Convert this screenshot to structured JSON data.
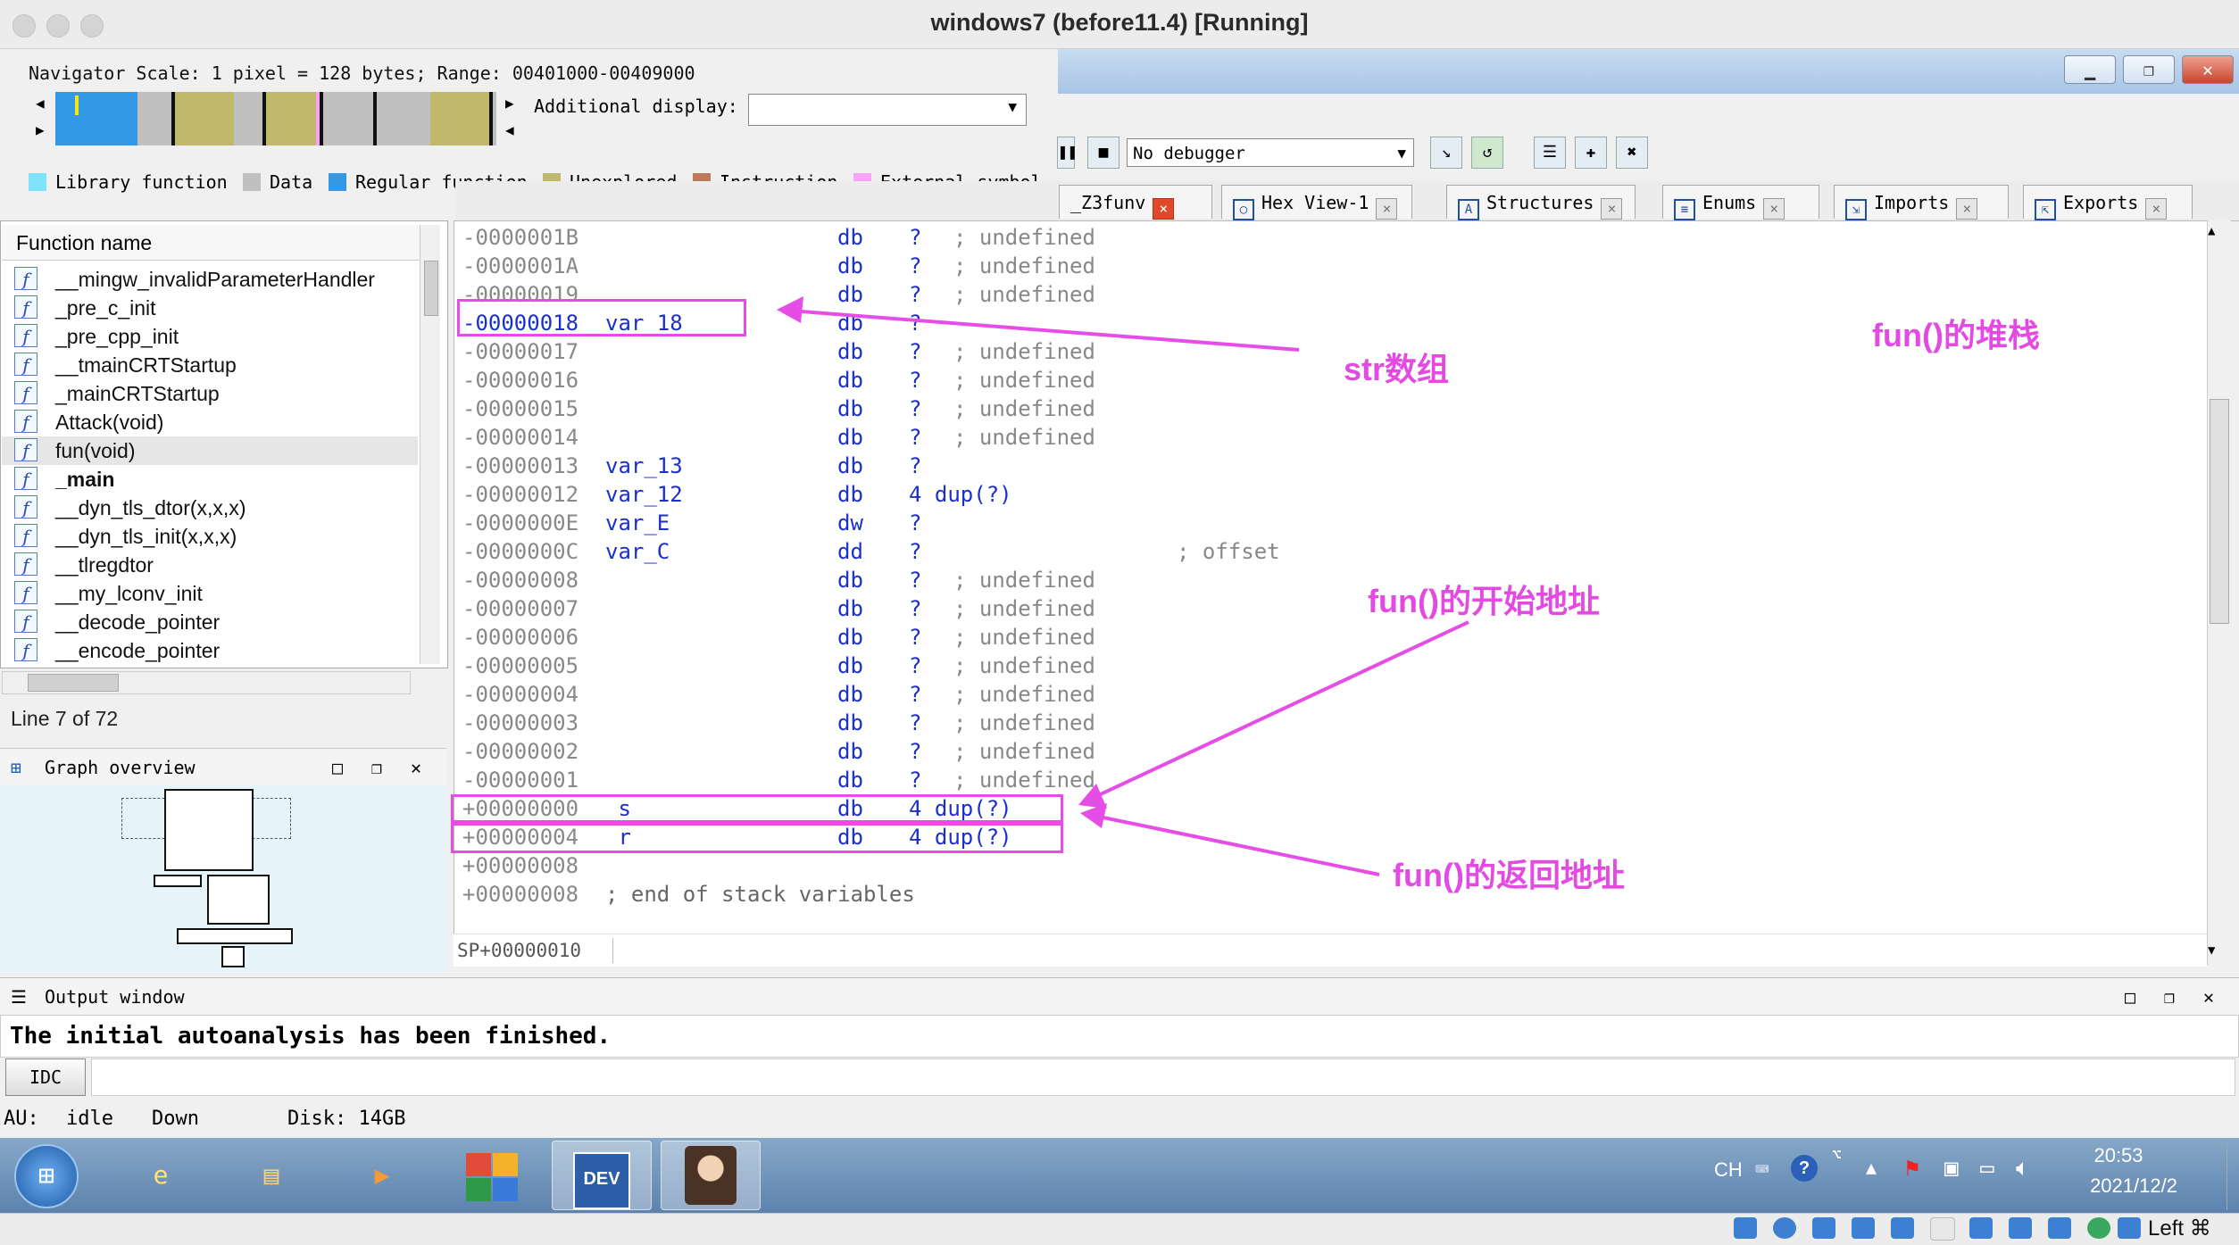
{
  "window": {
    "title": "windows7 (before11.4) [Running]"
  },
  "navigator": {
    "scale_text": "Navigator Scale: 1 pixel = 128 bytes; Range: 00401000-00409000",
    "additional_display_label": "Additional display:",
    "legend": [
      {
        "label": "Library function",
        "color": "#7fe3f9"
      },
      {
        "label": "Data",
        "color": "#c0c0c0"
      },
      {
        "label": "Regular function",
        "color": "#3399e6"
      },
      {
        "label": "Unexplored",
        "color": "#c0b86a"
      },
      {
        "label": "Instruction",
        "color": "#c0785a"
      },
      {
        "label": "External symbol",
        "color": "#f7a4f7"
      }
    ]
  },
  "toolbar": {
    "debugger_select": "No debugger"
  },
  "tabs": [
    {
      "label": "_Z3funv",
      "active": true
    },
    {
      "label": "Hex View-1"
    },
    {
      "label": "Structures"
    },
    {
      "label": "Enums"
    },
    {
      "label": "Imports"
    },
    {
      "label": "Exports"
    }
  ],
  "functions": {
    "header": "Function name",
    "items": [
      "__mingw_invalidParameterHandler",
      "_pre_c_init",
      "_pre_cpp_init",
      "__tmainCRTStartup",
      "_mainCRTStartup",
      "Attack(void)",
      "fun(void)",
      "_main",
      "__dyn_tls_dtor(x,x,x)",
      "__dyn_tls_init(x,x,x)",
      "__tlregdtor",
      "__my_lconv_init",
      "__decode_pointer",
      "__encode_pointer"
    ],
    "selected": "fun(void)",
    "line_status": "Line 7 of 72"
  },
  "graph_overview": {
    "title": "Graph overview"
  },
  "stack": {
    "lines": [
      {
        "addr": "-0000001B",
        "name": "",
        "ins": "db",
        "op": "?",
        "cmt": "; undefined"
      },
      {
        "addr": "-0000001A",
        "name": "",
        "ins": "db",
        "op": "?",
        "cmt": "; undefined"
      },
      {
        "addr": "-00000019",
        "name": "",
        "ins": "db",
        "op": "?",
        "cmt": "; undefined"
      },
      {
        "addr": "-00000018",
        "name": "var_18",
        "ins": "db",
        "op": "?",
        "cmt": ""
      },
      {
        "addr": "-00000017",
        "name": "",
        "ins": "db",
        "op": "?",
        "cmt": "; undefined"
      },
      {
        "addr": "-00000016",
        "name": "",
        "ins": "db",
        "op": "?",
        "cmt": "; undefined"
      },
      {
        "addr": "-00000015",
        "name": "",
        "ins": "db",
        "op": "?",
        "cmt": "; undefined"
      },
      {
        "addr": "-00000014",
        "name": "",
        "ins": "db",
        "op": "?",
        "cmt": "; undefined"
      },
      {
        "addr": "-00000013",
        "name": "var_13",
        "ins": "db",
        "op": "?",
        "cmt": ""
      },
      {
        "addr": "-00000012",
        "name": "var_12",
        "ins": "db",
        "op": "4 dup(?)",
        "cmt": ""
      },
      {
        "addr": "-0000000E",
        "name": "var_E",
        "ins": "dw",
        "op": "?",
        "cmt": ""
      },
      {
        "addr": "-0000000C",
        "name": "var_C",
        "ins": "dd",
        "op": "?",
        "cmt": "; offset"
      },
      {
        "addr": "-00000008",
        "name": "",
        "ins": "db",
        "op": "?",
        "cmt": "; undefined"
      },
      {
        "addr": "-00000007",
        "name": "",
        "ins": "db",
        "op": "?",
        "cmt": "; undefined"
      },
      {
        "addr": "-00000006",
        "name": "",
        "ins": "db",
        "op": "?",
        "cmt": "; undefined"
      },
      {
        "addr": "-00000005",
        "name": "",
        "ins": "db",
        "op": "?",
        "cmt": "; undefined"
      },
      {
        "addr": "-00000004",
        "name": "",
        "ins": "db",
        "op": "?",
        "cmt": "; undefined"
      },
      {
        "addr": "-00000003",
        "name": "",
        "ins": "db",
        "op": "?",
        "cmt": "; undefined"
      },
      {
        "addr": "-00000002",
        "name": "",
        "ins": "db",
        "op": "?",
        "cmt": "; undefined"
      },
      {
        "addr": "-00000001",
        "name": "",
        "ins": "db",
        "op": "?",
        "cmt": "; undefined"
      },
      {
        "addr": "+00000000",
        "name": " s",
        "ins": "db",
        "op": "4 dup(?)",
        "cmt": ""
      },
      {
        "addr": "+00000004",
        "name": " r",
        "ins": "db",
        "op": "4 dup(?)",
        "cmt": ""
      },
      {
        "addr": "+00000008",
        "name": "",
        "ins": "",
        "op": "",
        "cmt": ""
      },
      {
        "addr": "+00000008",
        "name": "; end of stack variables",
        "ins": "",
        "op": "",
        "cmt": ""
      }
    ],
    "sp_text": "SP+00000010"
  },
  "annotations": {
    "str_array": "str数组",
    "fun_stack": "fun()的堆栈",
    "fun_start": "fun()的开始地址",
    "fun_return": "fun()的返回地址"
  },
  "output": {
    "title": "Output window",
    "message": "The initial autoanalysis has been finished.",
    "idc_button": "IDC"
  },
  "status": {
    "au": "AU:",
    "state": "idle",
    "direction": "Down",
    "disk": "Disk: 14GB"
  },
  "taskbar": {
    "lang": "CH",
    "time": "20:53",
    "date": "2021/12/2"
  },
  "vbox": {
    "host_key": "Left ⌘"
  }
}
